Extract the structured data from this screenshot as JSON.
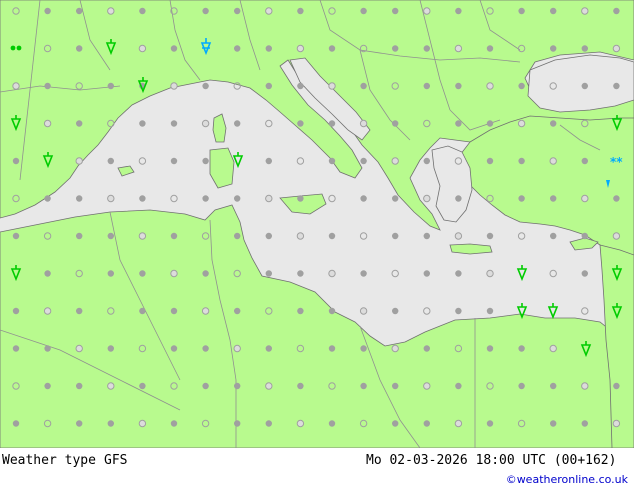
{
  "footer": {
    "left_label": "Weather type",
    "model": "GFS",
    "datetime": "Mo 02-03-2026 18:00 UTC (00+162)",
    "credit": "©weatheronline.co.uk"
  },
  "colors": {
    "land": "#b8fa8e",
    "sea": "#e8e8e8",
    "border": "#909090",
    "coast": "#707070",
    "dot": "#a0a0a0",
    "rain_symbol": "#00cc00",
    "snow_symbol": "#00aaff"
  },
  "legend_symbols": {
    "dot_filled": "cloudy-dot-icon",
    "dot_half": "partly-cloudy-dot-icon",
    "dot_open": "clear-dot-icon",
    "rain": "rain-shower-icon",
    "snow": "snow-icon"
  }
}
